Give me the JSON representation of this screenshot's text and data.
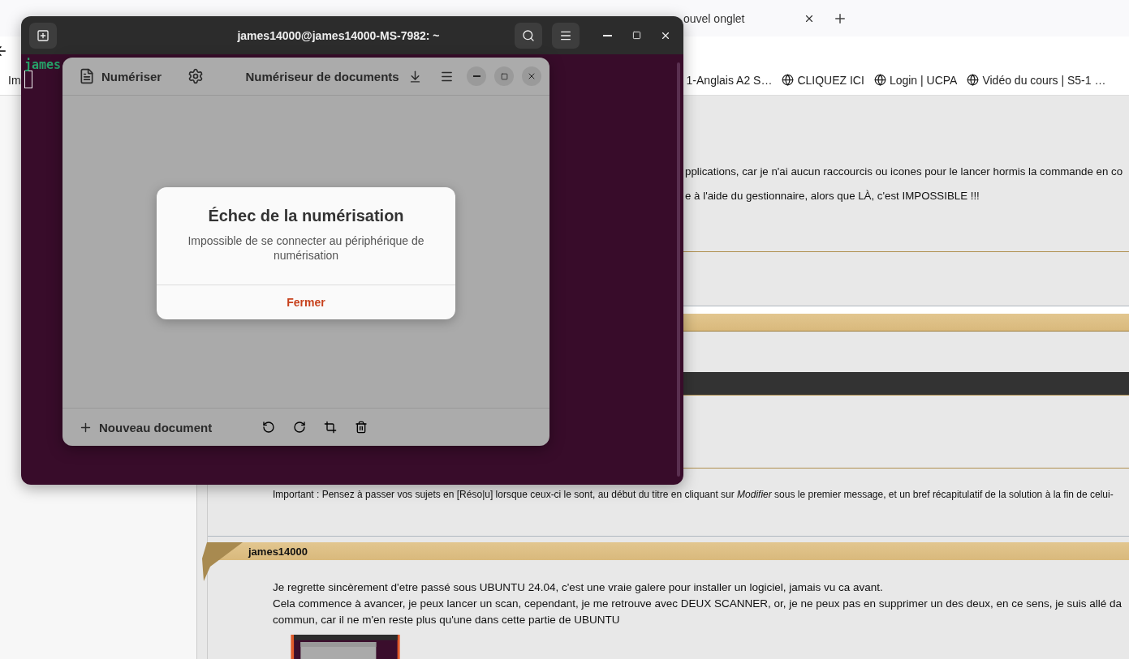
{
  "browser": {
    "tabs": [
      {
        "label": "ouvel onglet",
        "selected": false
      }
    ],
    "bookmarks": [
      {
        "label": "Im",
        "kind": "cut"
      },
      {
        "label": "1-Anglais A2 S…",
        "kind": "cut"
      },
      {
        "label": "CLIQUEZ ICI",
        "kind": "web"
      },
      {
        "label": "Login | UCPA",
        "kind": "web"
      },
      {
        "label": "Vidéo du cours | S5-1 …",
        "kind": "web"
      }
    ]
  },
  "forum": {
    "post_excerpt": [
      "pplications, car je n'ai aucun raccourcis ou icones pour le lancer hormis la commande en co",
      "e à l'aide du gestionnaire, alors que LÀ, c'est IMPOSSIBLE !!!"
    ],
    "notice": "Important : Pensez à passer vos sujets en [Réso|u] lorsque ceux-ci le sont, au début du titre en cliquant sur *Modifier* sous le premier message, et un bref récapitulatif de la solution à la fin de celui-",
    "reply": {
      "author": "james14000",
      "lines": [
        "Je regrette sincèrement d'etre passé sous UBUNTU 24.04, c'est une vraie galere pour installer un logiciel, jamais vu ca avant.",
        "Cela commence à avancer, je peux lancer un scan, cependant, je me retrouve avec DEUX SCANNER, or, je ne peux pas en supprimer un des deux, en ce sens, je suis allé da",
        "commun, car il ne m'en reste plus qu'une dans cette partie de UBUNTU"
      ]
    }
  },
  "terminal": {
    "title": "james14000@james14000-MS-7982: ~",
    "prompt": "james"
  },
  "scanner": {
    "scan_button": "Numériser",
    "title": "Numériseur de documents",
    "new_document": "Nouveau document",
    "dialog": {
      "title": "Échec de la numérisation",
      "message": "Impossible de se connecter au périphérique de numérisation",
      "button": "Fermer"
    }
  }
}
